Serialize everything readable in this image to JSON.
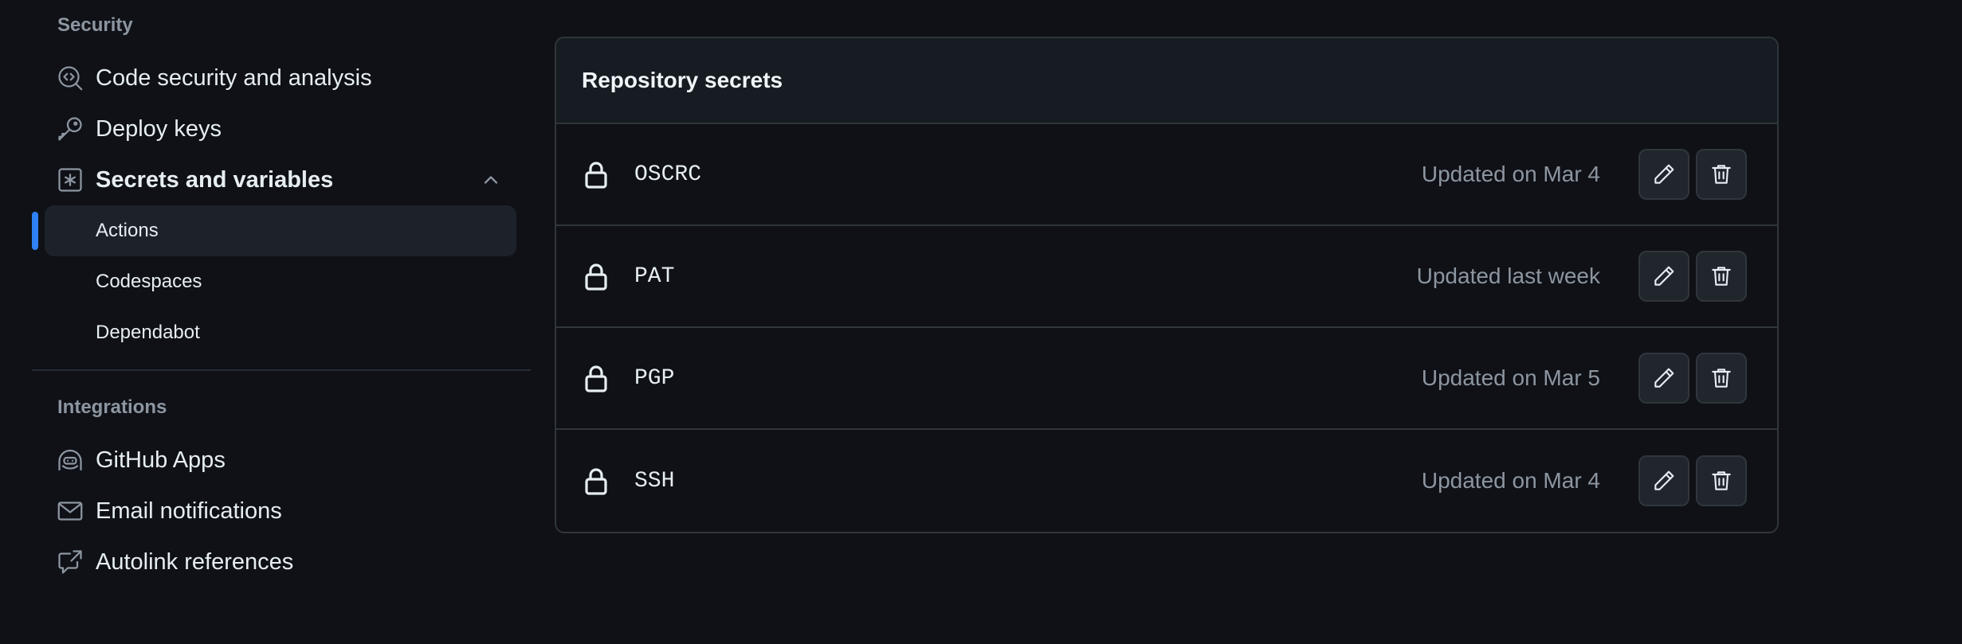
{
  "sidebar": {
    "security_heading": "Security",
    "items": [
      {
        "label": "Code security and analysis",
        "icon": "codescan-icon"
      },
      {
        "label": "Deploy keys",
        "icon": "key-icon"
      },
      {
        "label": "Secrets and variables",
        "icon": "asterisk-icon",
        "expanded": true
      }
    ],
    "sub_items": [
      {
        "label": "Actions",
        "active": true
      },
      {
        "label": "Codespaces",
        "active": false
      },
      {
        "label": "Dependabot",
        "active": false
      }
    ],
    "integrations_heading": "Integrations",
    "integration_items": [
      {
        "label": "GitHub Apps",
        "icon": "copilot-icon"
      },
      {
        "label": "Email notifications",
        "icon": "mail-icon"
      },
      {
        "label": "Autolink references",
        "icon": "cross-reference-icon"
      }
    ]
  },
  "panel": {
    "title": "Repository secrets",
    "secrets": [
      {
        "name": "OSCRC",
        "updated": "Updated on Mar 4"
      },
      {
        "name": "PAT",
        "updated": "Updated last week"
      },
      {
        "name": "PGP",
        "updated": "Updated on Mar 5"
      },
      {
        "name": "SSH",
        "updated": "Updated on Mar 4"
      }
    ]
  },
  "colors": {
    "background": "#0f1117",
    "accent": "#2f81f7",
    "muted_text": "#8d96a0",
    "border": "#30363d"
  }
}
